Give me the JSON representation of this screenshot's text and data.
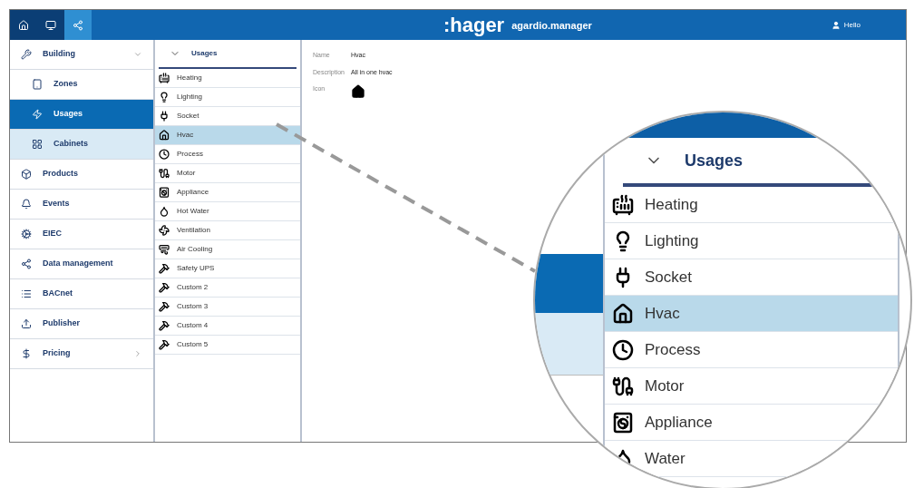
{
  "topbar": {
    "nav_buttons": [
      {
        "selected": false
      },
      {
        "selected": false
      },
      {
        "selected": true
      }
    ],
    "brand": ":hager",
    "product": "agardio.manager",
    "user": "Hello"
  },
  "sidebar": {
    "items": [
      {
        "label": "Building",
        "selected": false,
        "highlighted": false,
        "kind": "group",
        "expanded": true
      },
      {
        "label": "Zones",
        "selected": false,
        "highlighted": false,
        "kind": "sub"
      },
      {
        "label": "Usages",
        "selected": true,
        "highlighted": false,
        "kind": "sub"
      },
      {
        "label": "Cabinets",
        "selected": false,
        "highlighted": true,
        "kind": "sub"
      },
      {
        "label": "Products",
        "selected": false,
        "highlighted": false,
        "kind": "item"
      },
      {
        "label": "Events",
        "selected": false,
        "highlighted": false,
        "kind": "item"
      },
      {
        "label": "EIEC",
        "selected": false,
        "highlighted": false,
        "kind": "item"
      },
      {
        "label": "Data management",
        "selected": false,
        "highlighted": false,
        "kind": "item"
      },
      {
        "label": "BACnet",
        "selected": false,
        "highlighted": false,
        "kind": "item"
      },
      {
        "label": "Publisher",
        "selected": false,
        "highlighted": false,
        "kind": "item"
      },
      {
        "label": "Pricing",
        "selected": false,
        "highlighted": false,
        "kind": "group",
        "expanded": false
      }
    ]
  },
  "usages": {
    "title": "Usages",
    "items": [
      {
        "label": "Heating",
        "selected": false
      },
      {
        "label": "Lighting",
        "selected": false
      },
      {
        "label": "Socket",
        "selected": false
      },
      {
        "label": "Hvac",
        "selected": true
      },
      {
        "label": "Process",
        "selected": false
      },
      {
        "label": "Motor",
        "selected": false
      },
      {
        "label": "Appliance",
        "selected": false
      },
      {
        "label": "Hot Water",
        "selected": false
      },
      {
        "label": "Ventilation",
        "selected": false
      },
      {
        "label": "Air Cooling",
        "selected": false
      },
      {
        "label": "Safety UPS",
        "selected": false
      },
      {
        "label": "Custom 2",
        "selected": false
      },
      {
        "label": "Custom 3",
        "selected": false
      },
      {
        "label": "Custom 4",
        "selected": false
      },
      {
        "label": "Custom 5",
        "selected": false
      }
    ]
  },
  "details": {
    "fields": [
      {
        "label": "Name",
        "value": "Hvac"
      },
      {
        "label": "Description",
        "value": "All in one hvac"
      }
    ],
    "icon_label": "Icon"
  },
  "magnifier": {
    "title": "Usages",
    "items": [
      {
        "label": "Heating",
        "selected": false
      },
      {
        "label": "Lighting",
        "selected": false
      },
      {
        "label": "Socket",
        "selected": false
      },
      {
        "label": "Hvac",
        "selected": true
      },
      {
        "label": "Process",
        "selected": false
      },
      {
        "label": "Motor",
        "selected": false
      },
      {
        "label": "Appliance",
        "selected": false
      },
      {
        "label": "Water",
        "selected": false
      }
    ]
  }
}
